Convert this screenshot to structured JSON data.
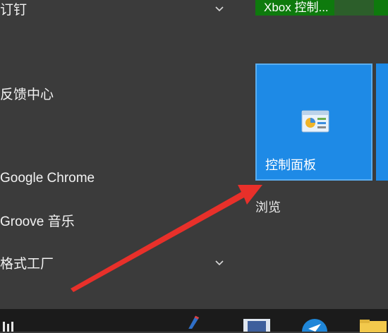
{
  "app_list": [
    {
      "label": "订钉",
      "has_chevron": true
    },
    {
      "label": "反馈中心",
      "has_chevron": false
    },
    {
      "label": "Google Chrome",
      "has_chevron": false
    },
    {
      "label": "Groove 音乐",
      "has_chevron": false
    },
    {
      "label": "格式工厂",
      "has_chevron": true
    }
  ],
  "tiles": {
    "xbox_label": "Xbox 控制...",
    "control_panel_label": "控制面板",
    "group_label": "浏览"
  },
  "colors": {
    "menu_bg": "#3b3b3b",
    "tile_blue": "#1e8ae6",
    "xbox_green": "#0e7a0d",
    "taskbar": "#1b1b1b",
    "arrow": "#e8302a"
  },
  "icons": {
    "chevron": "chevron-down-icon",
    "control_panel": "control-panel-icon",
    "taskbar_start": "start-icon",
    "taskbar_pen": "pen-app-icon",
    "taskbar_app": "app-icon",
    "taskbar_feedback": "feedback-app-icon",
    "taskbar_folder": "folder-icon"
  }
}
